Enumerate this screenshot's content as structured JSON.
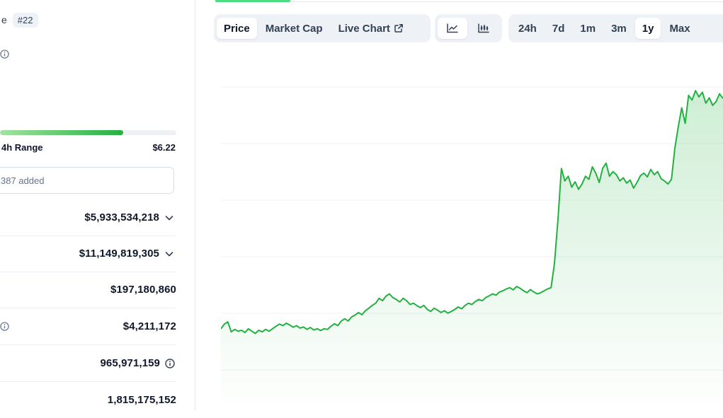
{
  "coin": {
    "rank_partial": "e",
    "rank_badge": "#22"
  },
  "price_range": {
    "label": "4h Range",
    "high": "$6.22",
    "position": 0.7
  },
  "portfolio": {
    "added_text": "387 added"
  },
  "stats": [
    {
      "value": "$5,933,534,218",
      "suffix_icon": "chevron-down-icon"
    },
    {
      "value": "$11,149,819,305",
      "suffix_icon": "chevron-down-icon"
    },
    {
      "value": "$197,180,860",
      "suffix_icon": ""
    },
    {
      "value": "$4,211,172",
      "left_icon": "info-icon"
    },
    {
      "value": "965,971,159",
      "suffix_icon": "info-icon"
    },
    {
      "value": "1,815,175,152",
      "suffix_icon": ""
    }
  ],
  "chart_tabs": {
    "view": [
      {
        "label": "Price",
        "active": true
      },
      {
        "label": "Market Cap",
        "active": false
      },
      {
        "label": "Live Chart",
        "active": false,
        "icon": "external-link-icon"
      }
    ],
    "chart_type": [
      {
        "icon": "line-chart-icon",
        "active": true
      },
      {
        "icon": "candlestick-chart-icon",
        "active": false
      }
    ],
    "range": [
      {
        "label": "24h",
        "active": false
      },
      {
        "label": "7d",
        "active": false
      },
      {
        "label": "1m",
        "active": false
      },
      {
        "label": "3m",
        "active": false
      },
      {
        "label": "1y",
        "active": true
      },
      {
        "label": "Max",
        "active": false
      }
    ]
  },
  "chart_data": {
    "type": "area",
    "color": "#22b140",
    "title": "",
    "grid": true,
    "y": [
      1.3,
      1.45,
      1.52,
      1.2,
      1.28,
      1.22,
      1.25,
      1.18,
      1.3,
      1.22,
      1.15,
      1.25,
      1.2,
      1.28,
      1.22,
      1.3,
      1.38,
      1.45,
      1.4,
      1.48,
      1.42,
      1.35,
      1.4,
      1.32,
      1.36,
      1.28,
      1.34,
      1.26,
      1.3,
      1.24,
      1.3,
      1.28,
      1.38,
      1.46,
      1.4,
      1.55,
      1.62,
      1.55,
      1.68,
      1.74,
      1.82,
      1.75,
      1.88,
      1.96,
      2.05,
      2.12,
      2.28,
      2.2,
      2.35,
      2.42,
      2.3,
      2.24,
      2.16,
      2.28,
      2.2,
      2.08,
      2.12,
      2.04,
      1.98,
      2.05,
      1.92,
      1.86,
      1.96,
      1.9,
      1.82,
      1.88,
      1.8,
      1.86,
      1.92,
      2.0,
      1.94,
      2.05,
      2.12,
      2.08,
      2.18,
      2.24,
      2.2,
      2.3,
      2.36,
      2.42,
      2.38,
      2.48,
      2.52,
      2.58,
      2.62,
      2.55,
      2.66,
      2.6,
      2.52,
      2.46,
      2.56,
      2.48,
      2.42,
      2.46,
      2.52,
      2.58,
      2.62,
      3.4,
      4.8,
      6.45,
      6.05,
      6.2,
      5.85,
      6.02,
      5.78,
      5.95,
      6.2,
      6.1,
      6.5,
      6.3,
      6.0,
      6.45,
      6.62,
      6.2,
      6.35,
      6.25,
      6.05,
      6.15,
      5.98,
      6.08,
      5.82,
      6.0,
      6.22,
      6.3,
      6.18,
      6.42,
      6.25,
      6.35,
      6.12,
      6.05,
      5.95,
      6.1,
      7.1,
      7.8,
      8.4,
      7.9,
      8.8,
      8.65,
      8.95,
      8.75,
      8.9,
      8.55,
      8.72,
      8.48,
      8.6,
      8.85,
      8.7
    ],
    "ylim": [
      0,
      10.5
    ]
  }
}
